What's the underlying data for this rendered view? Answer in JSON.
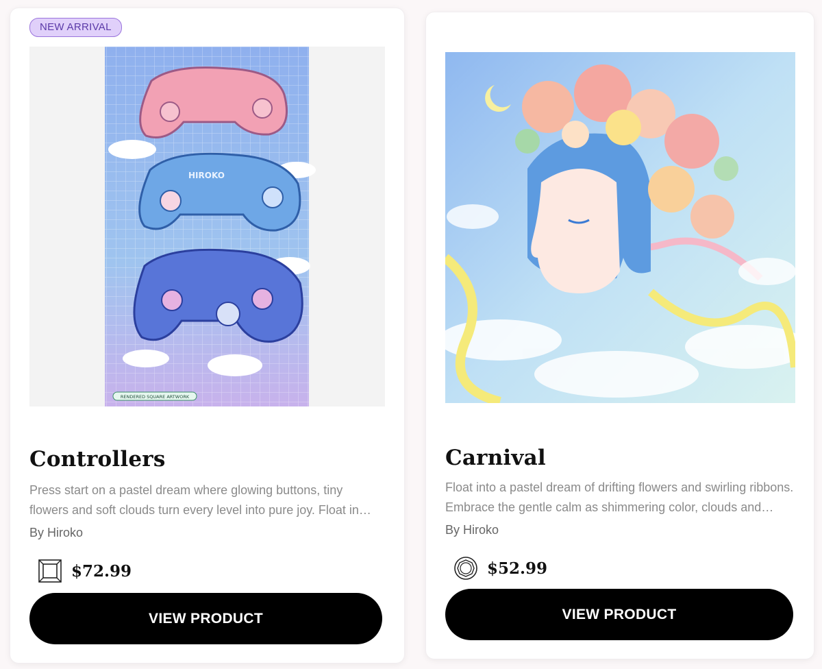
{
  "products": [
    {
      "badge": "NEW ARRIVAL",
      "title": "Controllers",
      "description": "Press start on a pastel dream where glowing buttons, tiny flowers and soft clouds turn every level into pure joy. Float into a world of playful pixel magic.",
      "author": "By Hiroko",
      "price": "$72.99",
      "icon": "square-frame-icon",
      "button_label": "VIEW PRODUCT",
      "artwork_caption": "RENDERED SQUARE ARTWORK"
    },
    {
      "title": "Carnival",
      "description": "Float into a pastel dream of drifting flowers and swirling ribbons. Embrace the gentle calm as shimmering color, clouds and waves carry you away.",
      "author": "By Hiroko",
      "price": "$52.99",
      "icon": "round-frame-icon",
      "button_label": "VIEW PRODUCT"
    }
  ],
  "colors": {
    "badge_bg": "#e0d0fa",
    "badge_border": "#9a74dc",
    "badge_text": "#5b3aa8",
    "button_bg": "#000000",
    "button_text": "#ffffff"
  }
}
